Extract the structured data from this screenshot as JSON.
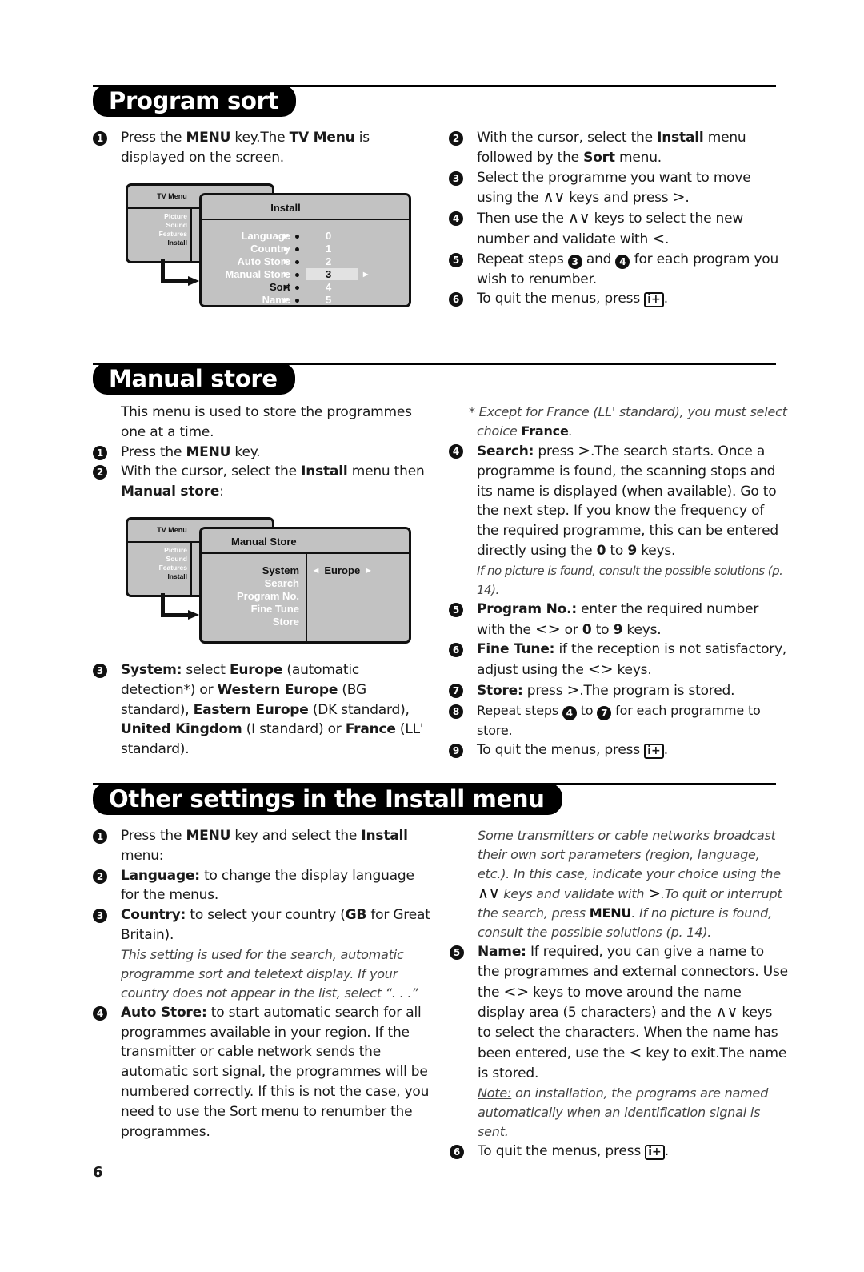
{
  "page_number": "6",
  "sections": {
    "program_sort": {
      "title": "Program sort",
      "left": {
        "step1": {
          "num": "1",
          "t1": "Press the ",
          "b1": "MENU",
          "t2": " key.The ",
          "b2": "TV Menu",
          "t3": " is displayed on the screen."
        }
      },
      "right": {
        "step2": {
          "num": "2",
          "t1": "With the cursor, select the ",
          "b1": "Install",
          "t2": " menu followed by the ",
          "b2": "Sort",
          "t3": " menu."
        },
        "step3": {
          "num": "3",
          "t1": "Select the programme you want to move using the ",
          "keys1": "∧∨",
          "t2": " keys and press ",
          "keys2": ">",
          "t3": "."
        },
        "step4": {
          "num": "4",
          "t1": "Then use the ",
          "keys1": "∧∨",
          "t2": " keys to select the new number and validate with ",
          "keys2": "<",
          "t3": "."
        },
        "step5": {
          "num": "5",
          "t1": "Repeat steps ",
          "ref1": "3",
          "t2": " and ",
          "ref2": "4",
          "t3": " for each program you wish to renumber."
        },
        "step6": {
          "num": "6",
          "t1": "To quit the menus, press ",
          "key": "i+",
          "t2": "."
        }
      },
      "tv_menu": {
        "back_title": "TV Menu",
        "back_items": [
          "Picture",
          "Sound",
          "Features",
          "Install"
        ],
        "front_title": "Install",
        "rows": [
          {
            "label": "Language",
            "value": "0"
          },
          {
            "label": "Country",
            "value": "1"
          },
          {
            "label": "Auto Store",
            "value": "2"
          },
          {
            "label": "Manual Store",
            "value": "3"
          },
          {
            "label": "Sort",
            "value": "4"
          },
          {
            "label": "Name",
            "value": "5"
          }
        ],
        "selected_label": "Sort",
        "highlighted_value": "3"
      }
    },
    "manual_store": {
      "title": "Manual store",
      "left": {
        "intro": "This menu is used to store the programmes one at a time.",
        "step1": {
          "num": "1",
          "t1": "Press the ",
          "b1": "MENU",
          "t2": " key."
        },
        "step2": {
          "num": "2",
          "t1": "With the cursor, select the ",
          "b1": "Install",
          "t2": " menu then ",
          "b2": "Manual store",
          "t3": ":"
        },
        "step3": {
          "num": "3",
          "b1": "System:",
          "t1": " select ",
          "b2": "Europe",
          "t2": " (automatic detection*) or ",
          "b3": "Western Europe",
          "t3": " (BG standard), ",
          "b4": "Eastern Europe",
          "t4": " (DK standard), ",
          "b5": "United Kingdom",
          "t5": " (I standard) or ",
          "b6": "France",
          "t6": " (LL' standard)."
        }
      },
      "right": {
        "footnote": {
          "t1": "* Except for France (LL' standard), you must select choice ",
          "b1": "France",
          "t2": "."
        },
        "step4": {
          "num": "4",
          "b1": "Search:",
          "t1": " press ",
          "keys1": ">",
          "t2": ".The search starts. Once a programme is found, the scanning stops and its name is displayed (when available). Go to the next step. If you know the frequency of the required programme, this can be entered directly using the ",
          "b2": "0",
          "t3": " to ",
          "b3": "9",
          "t4": " keys."
        },
        "step4_note": "If no picture is found, consult the possible solutions (p. 14).",
        "step5": {
          "num": "5",
          "b1": "Program No.:",
          "t1": " enter the required number with the ",
          "keys1": "<>",
          "t2": " or ",
          "b2": "0",
          "t3": " to ",
          "b3": "9",
          "t4": " keys."
        },
        "step6": {
          "num": "6",
          "b1": "Fine Tune:",
          "t1": " if the reception is not satisfactory, adjust using the ",
          "keys1": "<>",
          "t2": " keys."
        },
        "step7": {
          "num": "7",
          "b1": "Store:",
          "t1": " press ",
          "keys1": ">",
          "t2": ".The program is stored."
        },
        "step8": {
          "num": "8",
          "t1": "Repeat steps ",
          "ref1": "4",
          "t2": " to ",
          "ref2": "7",
          "t3": " for each programme to store."
        },
        "step9": {
          "num": "9",
          "t1": "To quit the menus, press ",
          "key": "i+",
          "t2": "."
        }
      },
      "tv_menu": {
        "back_title": "TV Menu",
        "back_items": [
          "Picture",
          "Sound",
          "Features",
          "Install"
        ],
        "front_title": "Manual Store",
        "items": [
          "System",
          "Search",
          "Program No.",
          "Fine Tune",
          "Store"
        ],
        "selected_item": "System",
        "value": "Europe"
      }
    },
    "other_settings": {
      "title": "Other settings in the Install menu",
      "left": {
        "step1": {
          "num": "1",
          "t1": "Press the ",
          "b1": "MENU",
          "t2": " key and select the ",
          "b2": "Install",
          "t3": " menu:"
        },
        "step2": {
          "num": "2",
          "b1": "Language:",
          "t1": " to change the display language for the menus."
        },
        "step3": {
          "num": "3",
          "b1": "Country:",
          "t1": " to select your country (",
          "b2": "GB",
          "t2": " for Great Britain)."
        },
        "step3_note": "This setting is used for the search, automatic programme sort and teletext display. If your country does not appear in the list, select “. . .”",
        "step4": {
          "num": "4",
          "b1": "Auto Store:",
          "t1": " to start automatic search for all programmes available in your region. If the transmitter or cable network sends the automatic sort signal, the programmes will be numbered correctly. If this is not the case, you need to use the Sort menu to renumber the programmes."
        }
      },
      "right": {
        "note": {
          "t1": "Some transmitters or cable networks broadcast their own sort parameters (region, language, etc.). In this case, indicate your choice using the ",
          "keys1": "∧∨",
          "t2": " keys and validate with ",
          "keys2": ">",
          "t3": ".To quit or interrupt the search, press ",
          "b1": "MENU",
          "t4": ". If no picture is found, consult the possible solutions (p. 14)."
        },
        "step5": {
          "num": "5",
          "b1": "Name:",
          "t1": " If required, you can give a name to the programmes and external connectors. Use the ",
          "keys1": "<>",
          "t2": " keys to move around the name display area (5 characters) and the ",
          "keys2": "∧∨",
          "t3": " keys to select the characters. When the name has been entered, use the ",
          "keys3": "<",
          "t4": " key to exit.The name is stored."
        },
        "step5_note": {
          "label": "Note:",
          "text": " on installation, the programs are named automatically when an identification signal is sent."
        },
        "step6": {
          "num": "6",
          "t1": "To quit the menus, press ",
          "key": "i+",
          "t2": "."
        }
      }
    }
  }
}
